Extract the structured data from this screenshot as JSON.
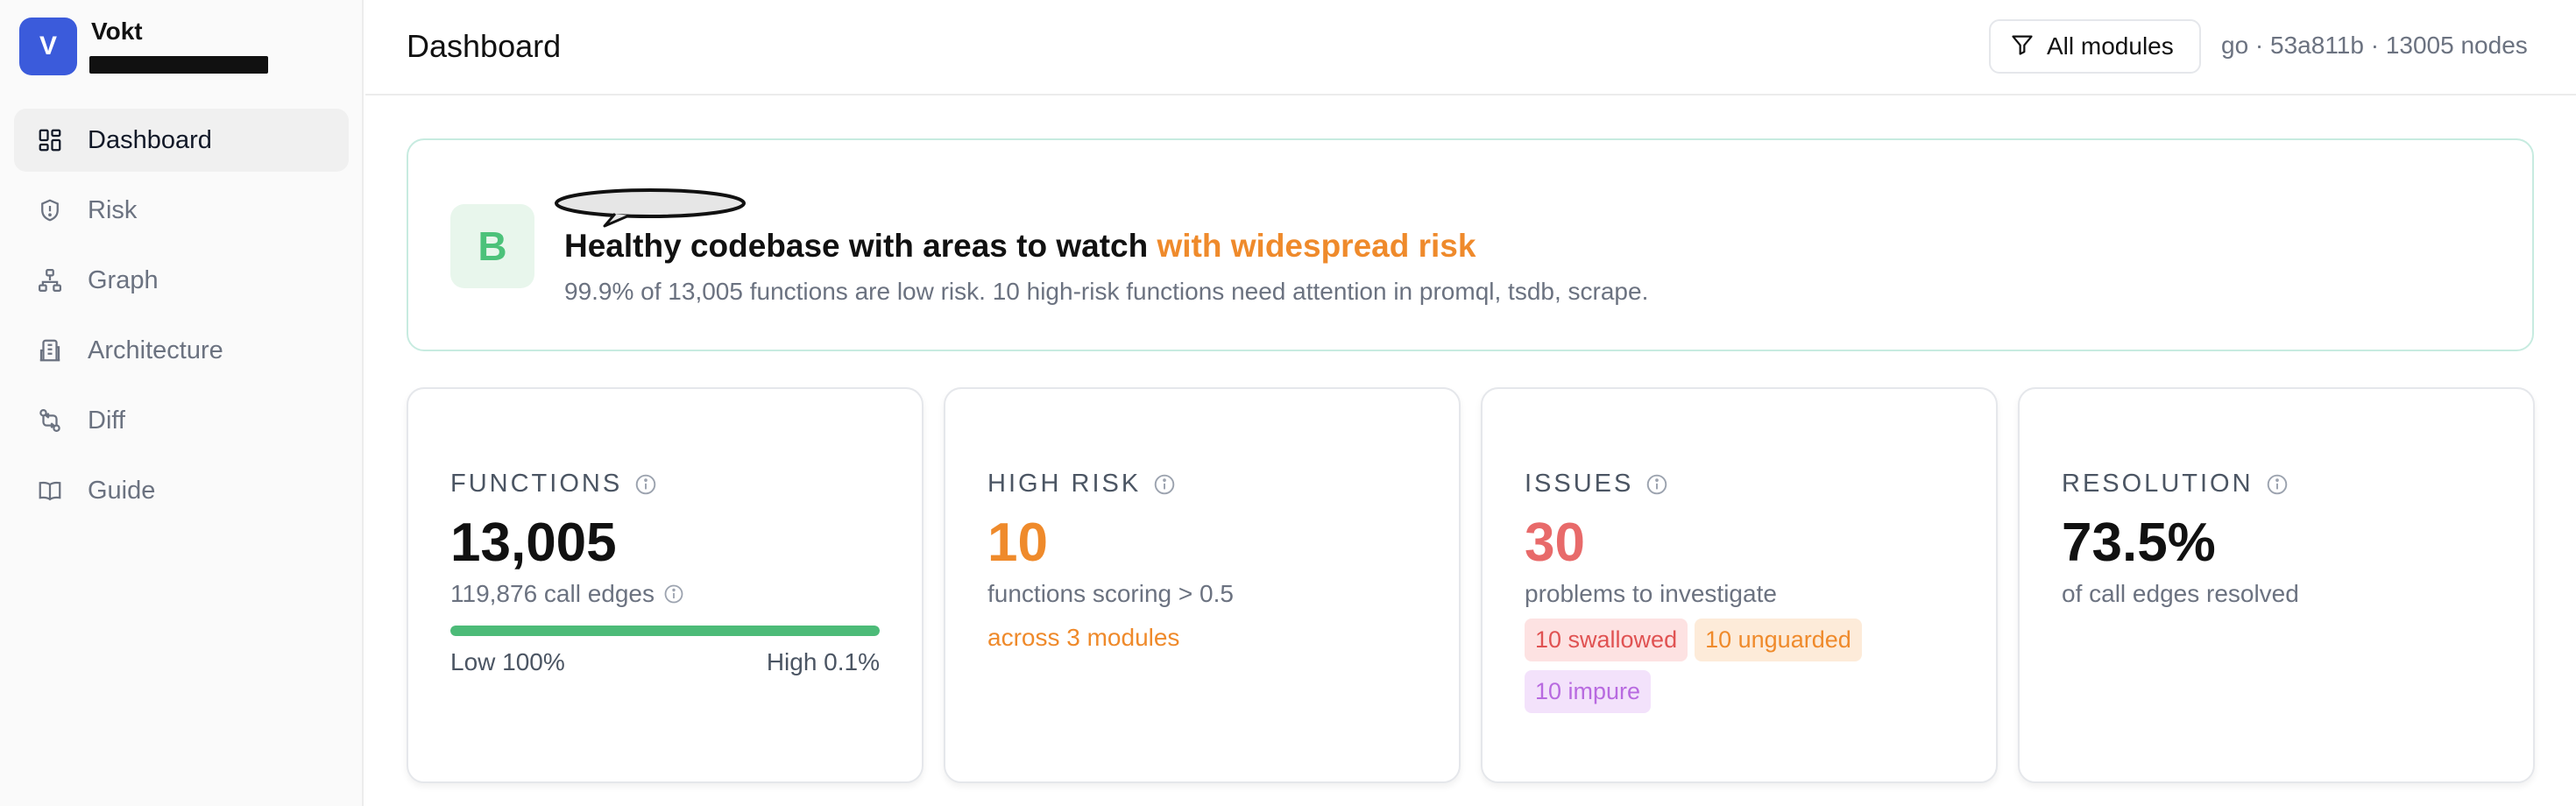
{
  "brand": {
    "initial": "V",
    "name": "Vokt"
  },
  "nav": {
    "items": [
      {
        "label": "Dashboard",
        "icon": "dashboard-icon",
        "active": true
      },
      {
        "label": "Risk",
        "icon": "shield-icon",
        "active": false
      },
      {
        "label": "Graph",
        "icon": "graph-icon",
        "active": false
      },
      {
        "label": "Architecture",
        "icon": "building-icon",
        "active": false
      },
      {
        "label": "Diff",
        "icon": "diff-icon",
        "active": false
      },
      {
        "label": "Guide",
        "icon": "book-icon",
        "active": false
      }
    ]
  },
  "header": {
    "title": "Dashboard",
    "filter_label": "All modules",
    "repo_meta": "go · 53a811b · 13005 nodes"
  },
  "banner": {
    "grade": "B",
    "title": "Healthy codebase with areas to watch",
    "title_highlight": "with widespread risk",
    "description": "99.9% of 13,005 functions are low risk. 10 high-risk functions need attention in promql, tsdb, scrape."
  },
  "cards": {
    "functions": {
      "label": "FUNCTIONS",
      "value": "13,005",
      "sub": "119,876 call edges",
      "low_risk_fraction": 1.0,
      "low_label": "Low 100%",
      "high_label": "High 0.1%"
    },
    "high_risk": {
      "label": "HIGH RISK",
      "value": "10",
      "sub": "functions scoring > 0.5",
      "extra": "across 3 modules"
    },
    "issues": {
      "label": "ISSUES",
      "value": "30",
      "sub": "problems to investigate",
      "tags": [
        "10 swallowed",
        "10 unguarded",
        "10 impure"
      ]
    },
    "resolution": {
      "label": "RESOLUTION",
      "value": "73.5%",
      "sub": "of call edges resolved"
    }
  },
  "colors": {
    "accent_blue": "#3b5bdb",
    "grade_green": "#4cc27a",
    "warning_orange": "#ef8a2b",
    "issue_red": "#e86a6a",
    "bar_green": "#4cbb78"
  }
}
